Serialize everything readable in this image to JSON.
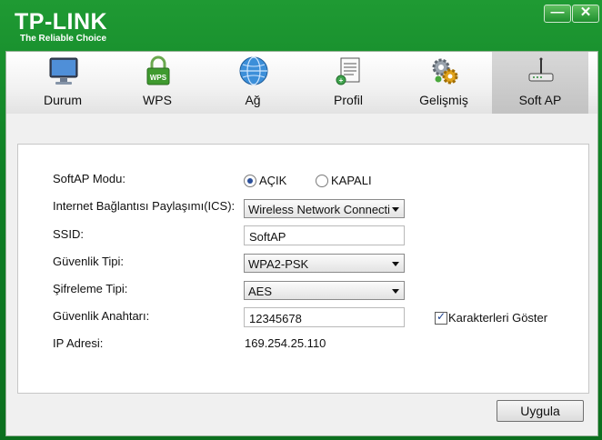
{
  "window": {
    "brand": "TP-LINK",
    "tagline": "The Reliable Choice",
    "minimize_label": "—",
    "close_label": "✕"
  },
  "tabs": [
    {
      "label": "Durum",
      "icon": "monitor-icon"
    },
    {
      "label": "WPS",
      "icon": "wps-lock-icon"
    },
    {
      "label": "Ağ",
      "icon": "globe-icon"
    },
    {
      "label": "Profil",
      "icon": "profile-document-icon"
    },
    {
      "label": "Gelişmiş",
      "icon": "gears-icon"
    },
    {
      "label": "Soft AP",
      "icon": "router-icon",
      "active": true
    }
  ],
  "form": {
    "softap_mode_label": "SoftAP Modu:",
    "mode_on": "AÇIK",
    "mode_off": "KAPALI",
    "mode_selected": "AÇIK",
    "ics_label": "Internet Bağlantısı Paylaşımı(ICS):",
    "ics_value": "Wireless Network Connecti",
    "ssid_label": "SSID:",
    "ssid_value": "SoftAP",
    "security_type_label": "Güvenlik Tipi:",
    "security_type_value": "WPA2-PSK",
    "encryption_type_label": "Şifreleme Tipi:",
    "encryption_type_value": "AES",
    "security_key_label": "Güvenlik Anahtarı:",
    "security_key_value": "12345678",
    "show_chars_label": "Karakterleri Göster",
    "show_chars_checked": true,
    "ip_label": "IP Adresi:",
    "ip_value": "169.254.25.110"
  },
  "apply_button": "Uygula",
  "colors": {
    "frame_green": "#0e7f24",
    "active_tab": "#c8c8c8"
  }
}
